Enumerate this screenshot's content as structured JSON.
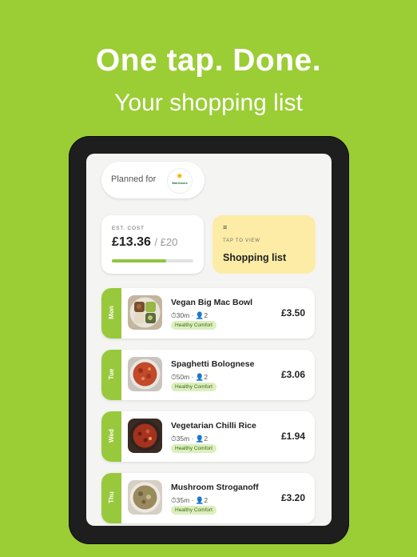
{
  "promo": {
    "headline": "One tap. Done.",
    "subline": "Your shopping list"
  },
  "planned": {
    "label": "Planned for",
    "store_logo_text": "Morrisons"
  },
  "cost": {
    "label": "EST. COST",
    "value": "£13.36",
    "budget": "/ £20",
    "progress_fraction": 0.668
  },
  "shopping_list": {
    "icon": "≡",
    "tap_label": "TAP TO VIEW",
    "title": "Shopping list"
  },
  "meals": [
    {
      "day": "Mon",
      "name": "Vegan Big Mac Bowl",
      "time": "30m",
      "servings": "2",
      "tag": "Healthy Comfort",
      "price": "£3.50"
    },
    {
      "day": "Tue",
      "name": "Spaghetti Bolognese",
      "time": "50m",
      "servings": "2",
      "tag": "Healthy Comfort",
      "price": "£3.06"
    },
    {
      "day": "Wed",
      "name": "Vegetarian Chilli Rice",
      "time": "35m",
      "servings": "2",
      "tag": "Healthy Comfort",
      "price": "£1.94"
    },
    {
      "day": "Thu",
      "name": "Mushroom Stroganoff",
      "time": "35m",
      "servings": "2",
      "tag": "Healthy Comfort",
      "price": "£3.20"
    }
  ],
  "icons": {
    "clock": "clock-icon",
    "person": "person-icon",
    "list": "list-icon"
  },
  "colors": {
    "background": "#9bcd35",
    "accent": "#98c93c",
    "list_card": "#fdeca5",
    "tag": "#dcefbf"
  }
}
